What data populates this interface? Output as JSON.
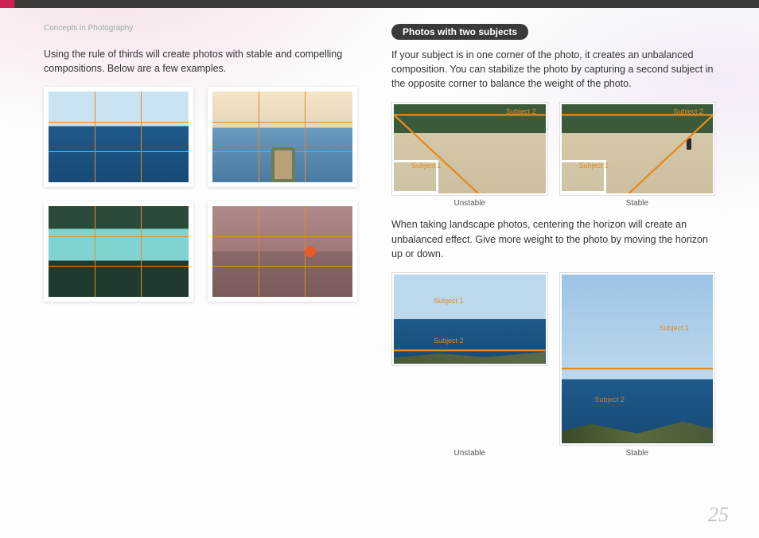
{
  "breadcrumb": "Concepts in Photography",
  "left": {
    "intro": "Using the rule of thirds will create photos with stable and compelling compositions. Below are a few examples."
  },
  "right": {
    "heading": "Photos with two subjects",
    "p1": "If your subject is in one corner of the photo, it creates an unbalanced composition. You can stabilize the photo by capturing a second subject in the opposite corner to balance the weight of the photo.",
    "p2": "When taking landscape photos, centering the horizon will create an unbalanced effect. Give more weight to the photo by moving the horizon up or down."
  },
  "labels": {
    "subject1": "Subject 1",
    "subject2": "Subject 2",
    "unstable": "Unstable",
    "stable": "Stable"
  },
  "pageNumber": "25"
}
